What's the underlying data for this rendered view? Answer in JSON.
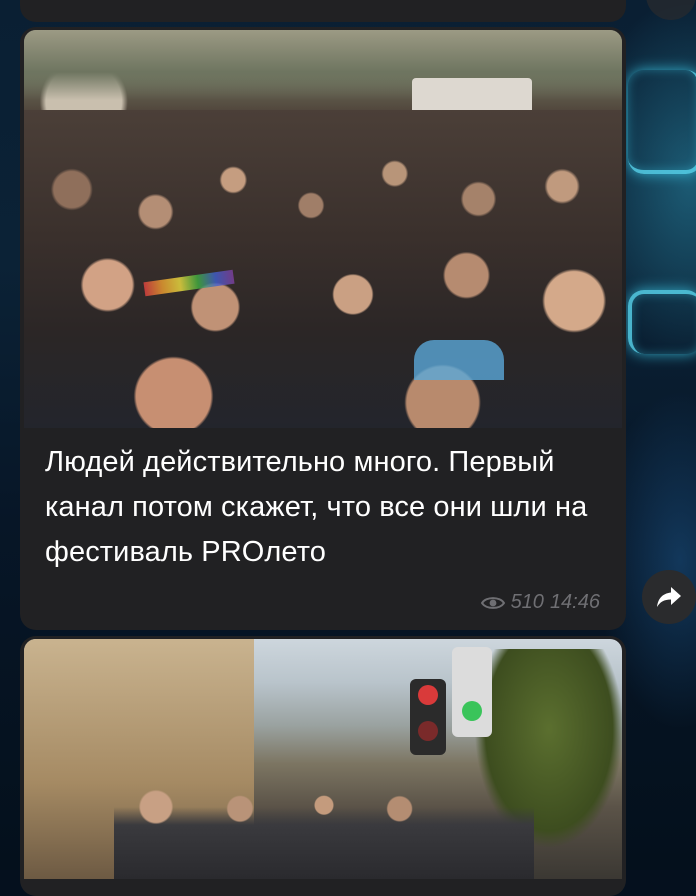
{
  "previous_message": {
    "meta": ""
  },
  "message": {
    "photo_label": "crowd-march-photo",
    "caption": "Людей действительно много. Первый канал потом скажет, что все они шли на фестиваль PROлето",
    "views": "510",
    "time": "14:46"
  },
  "next_message": {
    "photo_label": "city-street-photo"
  },
  "colors": {
    "bubble": "#212123",
    "meta_text": "#6f6f73",
    "caption_text": "#ffffff",
    "neon_accent": "#59d9f2"
  }
}
